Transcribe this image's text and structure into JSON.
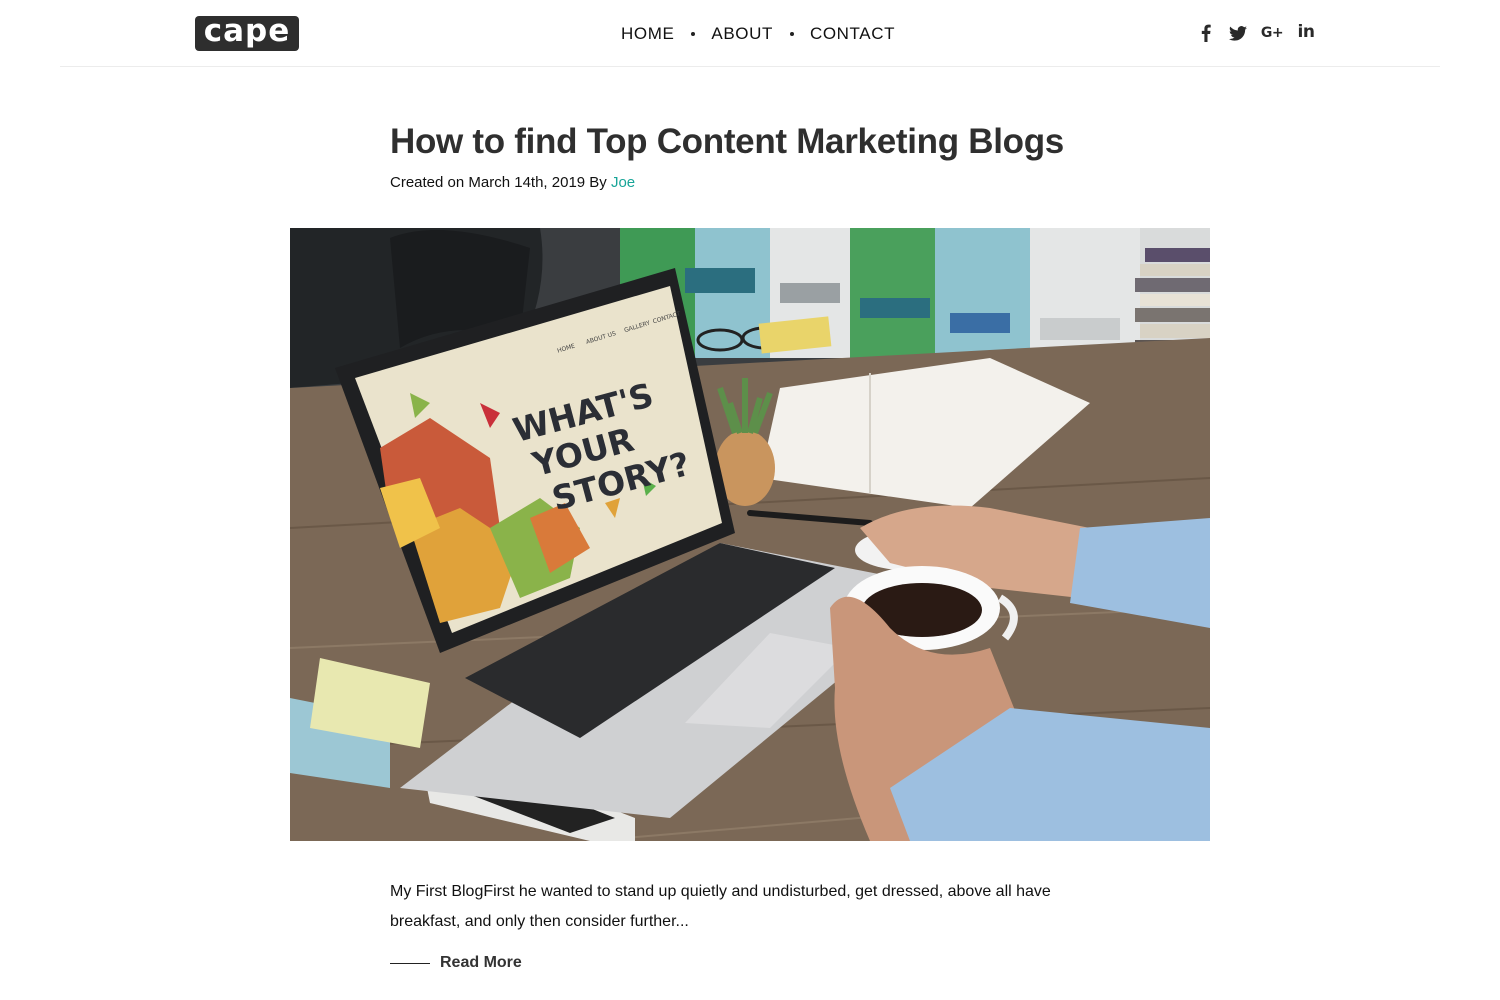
{
  "header": {
    "logo_text": "cape",
    "nav": [
      "HOME",
      "ABOUT",
      "CONTACT"
    ],
    "social_icons": [
      "facebook-icon",
      "twitter-icon",
      "google-plus-icon",
      "linkedin-icon"
    ],
    "google_plus_label": "G+",
    "linkedin_label": "in"
  },
  "post": {
    "title": "How to find Top Content Marketing Blogs",
    "meta_prefix": "Created on March 14th, 2019 By",
    "author": "Joe",
    "excerpt": "My First BlogFirst he wanted to stand up quietly and undisturbed, get dressed, above all have breakfast, and only then consider further...",
    "read_more": "Read More"
  },
  "hero_image": {
    "screen_text_line1": "WHAT'S",
    "screen_text_line2": "YOUR",
    "screen_text_line3": "STORY?",
    "screen_nav": [
      "HOME",
      "ABOUT US",
      "GALLERY",
      "CONTACT"
    ]
  },
  "colors": {
    "accent": "#18a598",
    "logo_bg": "#2e2e2e",
    "heading": "#2f2f2f"
  }
}
